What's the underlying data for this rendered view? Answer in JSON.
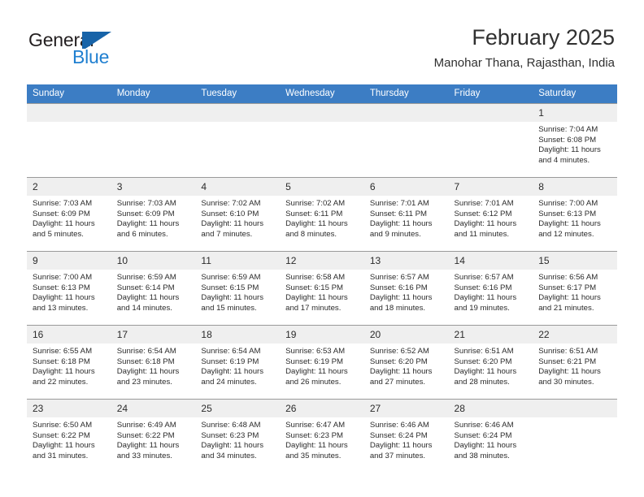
{
  "brand": {
    "name_top": "General",
    "name_bottom": "Blue",
    "accent_color": "#1763a8",
    "blue_text_color": "#1f7fd0"
  },
  "header": {
    "title": "February 2025",
    "subtitle": "Manohar Thana, Rajasthan, India",
    "header_bg": "#3c7dc4",
    "daynum_bg": "#efefef"
  },
  "weekday_headers": [
    "Sunday",
    "Monday",
    "Tuesday",
    "Wednesday",
    "Thursday",
    "Friday",
    "Saturday"
  ],
  "labels": {
    "sunrise": "Sunrise:",
    "sunset": "Sunset:",
    "daylight": "Daylight:"
  },
  "weeks": [
    [
      {
        "day": "",
        "sunrise": "",
        "sunset": "",
        "daylight1": "",
        "daylight2": "",
        "empty": true
      },
      {
        "day": "",
        "sunrise": "",
        "sunset": "",
        "daylight1": "",
        "daylight2": "",
        "empty": true
      },
      {
        "day": "",
        "sunrise": "",
        "sunset": "",
        "daylight1": "",
        "daylight2": "",
        "empty": true
      },
      {
        "day": "",
        "sunrise": "",
        "sunset": "",
        "daylight1": "",
        "daylight2": "",
        "empty": true
      },
      {
        "day": "",
        "sunrise": "",
        "sunset": "",
        "daylight1": "",
        "daylight2": "",
        "empty": true
      },
      {
        "day": "",
        "sunrise": "",
        "sunset": "",
        "daylight1": "",
        "daylight2": "",
        "empty": true
      },
      {
        "day": "1",
        "sunrise": "Sunrise: 7:04 AM",
        "sunset": "Sunset: 6:08 PM",
        "daylight1": "Daylight: 11 hours",
        "daylight2": "and 4 minutes.",
        "empty": false
      }
    ],
    [
      {
        "day": "2",
        "sunrise": "Sunrise: 7:03 AM",
        "sunset": "Sunset: 6:09 PM",
        "daylight1": "Daylight: 11 hours",
        "daylight2": "and 5 minutes.",
        "empty": false
      },
      {
        "day": "3",
        "sunrise": "Sunrise: 7:03 AM",
        "sunset": "Sunset: 6:09 PM",
        "daylight1": "Daylight: 11 hours",
        "daylight2": "and 6 minutes.",
        "empty": false
      },
      {
        "day": "4",
        "sunrise": "Sunrise: 7:02 AM",
        "sunset": "Sunset: 6:10 PM",
        "daylight1": "Daylight: 11 hours",
        "daylight2": "and 7 minutes.",
        "empty": false
      },
      {
        "day": "5",
        "sunrise": "Sunrise: 7:02 AM",
        "sunset": "Sunset: 6:11 PM",
        "daylight1": "Daylight: 11 hours",
        "daylight2": "and 8 minutes.",
        "empty": false
      },
      {
        "day": "6",
        "sunrise": "Sunrise: 7:01 AM",
        "sunset": "Sunset: 6:11 PM",
        "daylight1": "Daylight: 11 hours",
        "daylight2": "and 9 minutes.",
        "empty": false
      },
      {
        "day": "7",
        "sunrise": "Sunrise: 7:01 AM",
        "sunset": "Sunset: 6:12 PM",
        "daylight1": "Daylight: 11 hours",
        "daylight2": "and 11 minutes.",
        "empty": false
      },
      {
        "day": "8",
        "sunrise": "Sunrise: 7:00 AM",
        "sunset": "Sunset: 6:13 PM",
        "daylight1": "Daylight: 11 hours",
        "daylight2": "and 12 minutes.",
        "empty": false
      }
    ],
    [
      {
        "day": "9",
        "sunrise": "Sunrise: 7:00 AM",
        "sunset": "Sunset: 6:13 PM",
        "daylight1": "Daylight: 11 hours",
        "daylight2": "and 13 minutes.",
        "empty": false
      },
      {
        "day": "10",
        "sunrise": "Sunrise: 6:59 AM",
        "sunset": "Sunset: 6:14 PM",
        "daylight1": "Daylight: 11 hours",
        "daylight2": "and 14 minutes.",
        "empty": false
      },
      {
        "day": "11",
        "sunrise": "Sunrise: 6:59 AM",
        "sunset": "Sunset: 6:15 PM",
        "daylight1": "Daylight: 11 hours",
        "daylight2": "and 15 minutes.",
        "empty": false
      },
      {
        "day": "12",
        "sunrise": "Sunrise: 6:58 AM",
        "sunset": "Sunset: 6:15 PM",
        "daylight1": "Daylight: 11 hours",
        "daylight2": "and 17 minutes.",
        "empty": false
      },
      {
        "day": "13",
        "sunrise": "Sunrise: 6:57 AM",
        "sunset": "Sunset: 6:16 PM",
        "daylight1": "Daylight: 11 hours",
        "daylight2": "and 18 minutes.",
        "empty": false
      },
      {
        "day": "14",
        "sunrise": "Sunrise: 6:57 AM",
        "sunset": "Sunset: 6:16 PM",
        "daylight1": "Daylight: 11 hours",
        "daylight2": "and 19 minutes.",
        "empty": false
      },
      {
        "day": "15",
        "sunrise": "Sunrise: 6:56 AM",
        "sunset": "Sunset: 6:17 PM",
        "daylight1": "Daylight: 11 hours",
        "daylight2": "and 21 minutes.",
        "empty": false
      }
    ],
    [
      {
        "day": "16",
        "sunrise": "Sunrise: 6:55 AM",
        "sunset": "Sunset: 6:18 PM",
        "daylight1": "Daylight: 11 hours",
        "daylight2": "and 22 minutes.",
        "empty": false
      },
      {
        "day": "17",
        "sunrise": "Sunrise: 6:54 AM",
        "sunset": "Sunset: 6:18 PM",
        "daylight1": "Daylight: 11 hours",
        "daylight2": "and 23 minutes.",
        "empty": false
      },
      {
        "day": "18",
        "sunrise": "Sunrise: 6:54 AM",
        "sunset": "Sunset: 6:19 PM",
        "daylight1": "Daylight: 11 hours",
        "daylight2": "and 24 minutes.",
        "empty": false
      },
      {
        "day": "19",
        "sunrise": "Sunrise: 6:53 AM",
        "sunset": "Sunset: 6:19 PM",
        "daylight1": "Daylight: 11 hours",
        "daylight2": "and 26 minutes.",
        "empty": false
      },
      {
        "day": "20",
        "sunrise": "Sunrise: 6:52 AM",
        "sunset": "Sunset: 6:20 PM",
        "daylight1": "Daylight: 11 hours",
        "daylight2": "and 27 minutes.",
        "empty": false
      },
      {
        "day": "21",
        "sunrise": "Sunrise: 6:51 AM",
        "sunset": "Sunset: 6:20 PM",
        "daylight1": "Daylight: 11 hours",
        "daylight2": "and 28 minutes.",
        "empty": false
      },
      {
        "day": "22",
        "sunrise": "Sunrise: 6:51 AM",
        "sunset": "Sunset: 6:21 PM",
        "daylight1": "Daylight: 11 hours",
        "daylight2": "and 30 minutes.",
        "empty": false
      }
    ],
    [
      {
        "day": "23",
        "sunrise": "Sunrise: 6:50 AM",
        "sunset": "Sunset: 6:22 PM",
        "daylight1": "Daylight: 11 hours",
        "daylight2": "and 31 minutes.",
        "empty": false
      },
      {
        "day": "24",
        "sunrise": "Sunrise: 6:49 AM",
        "sunset": "Sunset: 6:22 PM",
        "daylight1": "Daylight: 11 hours",
        "daylight2": "and 33 minutes.",
        "empty": false
      },
      {
        "day": "25",
        "sunrise": "Sunrise: 6:48 AM",
        "sunset": "Sunset: 6:23 PM",
        "daylight1": "Daylight: 11 hours",
        "daylight2": "and 34 minutes.",
        "empty": false
      },
      {
        "day": "26",
        "sunrise": "Sunrise: 6:47 AM",
        "sunset": "Sunset: 6:23 PM",
        "daylight1": "Daylight: 11 hours",
        "daylight2": "and 35 minutes.",
        "empty": false
      },
      {
        "day": "27",
        "sunrise": "Sunrise: 6:46 AM",
        "sunset": "Sunset: 6:24 PM",
        "daylight1": "Daylight: 11 hours",
        "daylight2": "and 37 minutes.",
        "empty": false
      },
      {
        "day": "28",
        "sunrise": "Sunrise: 6:46 AM",
        "sunset": "Sunset: 6:24 PM",
        "daylight1": "Daylight: 11 hours",
        "daylight2": "and 38 minutes.",
        "empty": false
      },
      {
        "day": "",
        "sunrise": "",
        "sunset": "",
        "daylight1": "",
        "daylight2": "",
        "empty": true
      }
    ]
  ]
}
